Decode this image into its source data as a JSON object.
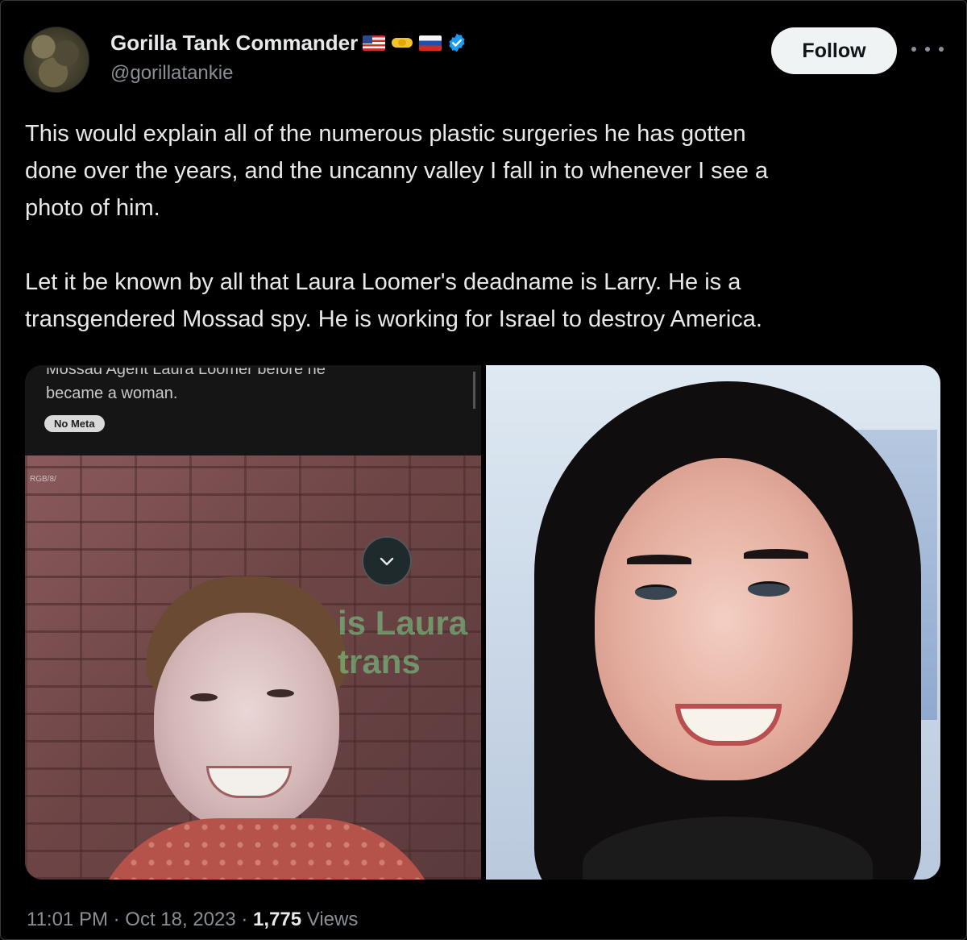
{
  "tweet": {
    "author": {
      "display_name": "Gorilla Tank Commander",
      "handle": "@gorillatankie",
      "verified": true,
      "badges": [
        "us-flag-icon",
        "handshake-icon",
        "russia-flag-icon"
      ]
    },
    "follow_label": "Follow",
    "more_icon": "more-horizontal-icon",
    "text_paragraphs": [
      "This would explain all of the numerous plastic surgeries he has gotten\ndone over the years, and the uncanny valley I fall in to whenever I see a\nphoto of him.",
      "Let it be known by all that Laura Loomer's deadname is Larry. He is a\ntransgendered Mossad spy. He is working for Israel to destroy America."
    ],
    "media": {
      "left_panel": {
        "cut_off_line": "Mossad Agent Laura Loomer before he",
        "caption": "became a woman.",
        "badge": "No Meta",
        "corner_label": "RGB/8/",
        "overlay_text_line1": "is Laura",
        "overlay_text_line2": "trans"
      }
    },
    "footer": {
      "time": "11:01 PM",
      "separator": " · ",
      "date": "Oct 18, 2023",
      "views_count": "1,775",
      "views_label": " Views"
    }
  },
  "colors": {
    "background": "#000000",
    "text_primary": "#e7e9ea",
    "text_secondary": "#8b9097",
    "follow_bg": "#eff3f4",
    "verified": "#1d9bf0"
  }
}
